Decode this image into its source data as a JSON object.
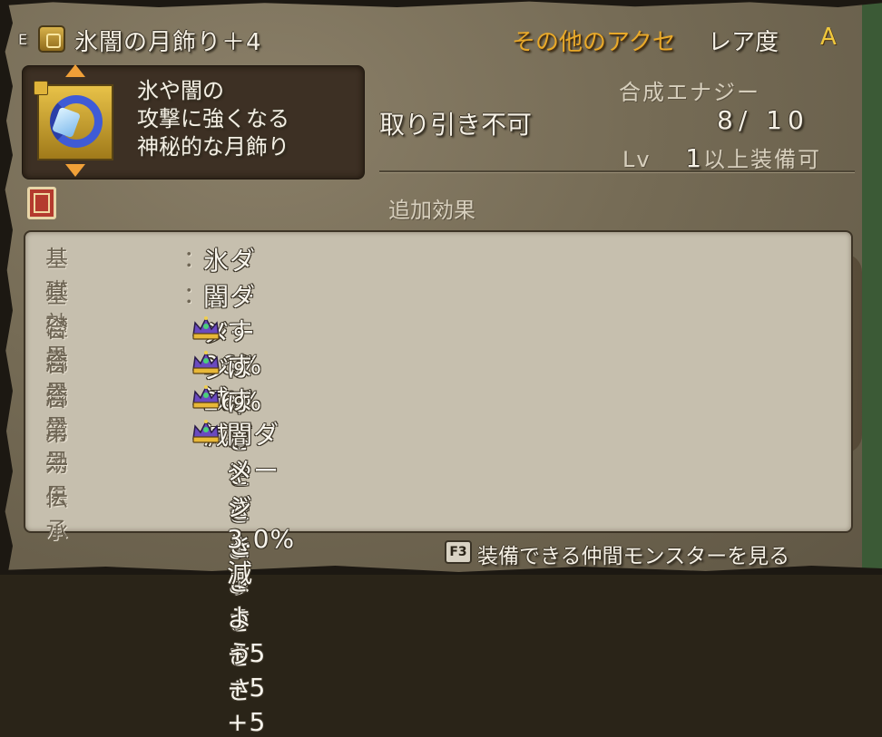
{
  "header": {
    "equip_mark": "E",
    "item_name": "氷闇の月飾り＋4",
    "category": "その他のアクセ",
    "rarity_label": "レア度",
    "rarity_value": "A"
  },
  "description": {
    "lines": [
      "氷や闇の",
      "攻撃に強くなる",
      "神秘的な月飾り"
    ]
  },
  "info": {
    "energy_label": "合成エナジー",
    "trade": "取り引き不可",
    "energy_value": "8/ 10",
    "lv_prefix": "Lv",
    "lv_value": "1",
    "lv_suffix": "以上装備可"
  },
  "effects": {
    "title": "追加効果",
    "rows": [
      {
        "type": "基礎効果",
        "sep": "：",
        "crown": false,
        "text": "氷ダメージ 26%減"
      },
      {
        "type": "基礎効果",
        "sep": "：",
        "crown": false,
        "text": "闇ダメージ 26%減"
      },
      {
        "type": "合成効果",
        "sep": "",
        "crown": true,
        "text": "すばやさときようさ +5"
      },
      {
        "type": "合成効果",
        "sep": "",
        "crown": true,
        "text": "すばやさときようさ +5"
      },
      {
        "type": "合成効果",
        "sep": "",
        "crown": true,
        "text": "すばやさときようさ +5"
      },
      {
        "type": "第一伝承",
        "sep": "",
        "crown": true,
        "text": "闇ダメージ 3.0%減"
      }
    ]
  },
  "footer": {
    "key": "F3",
    "text": "装備できる仲間モンスターを見る"
  },
  "colors": {
    "category": "#e8a92a",
    "rarity": "#f0c83c",
    "panel": "#c6bfae"
  },
  "icons": [
    "ribbon-icon",
    "crescent-moon-item-icon",
    "lock-icon",
    "book-icon",
    "crown-icon"
  ]
}
